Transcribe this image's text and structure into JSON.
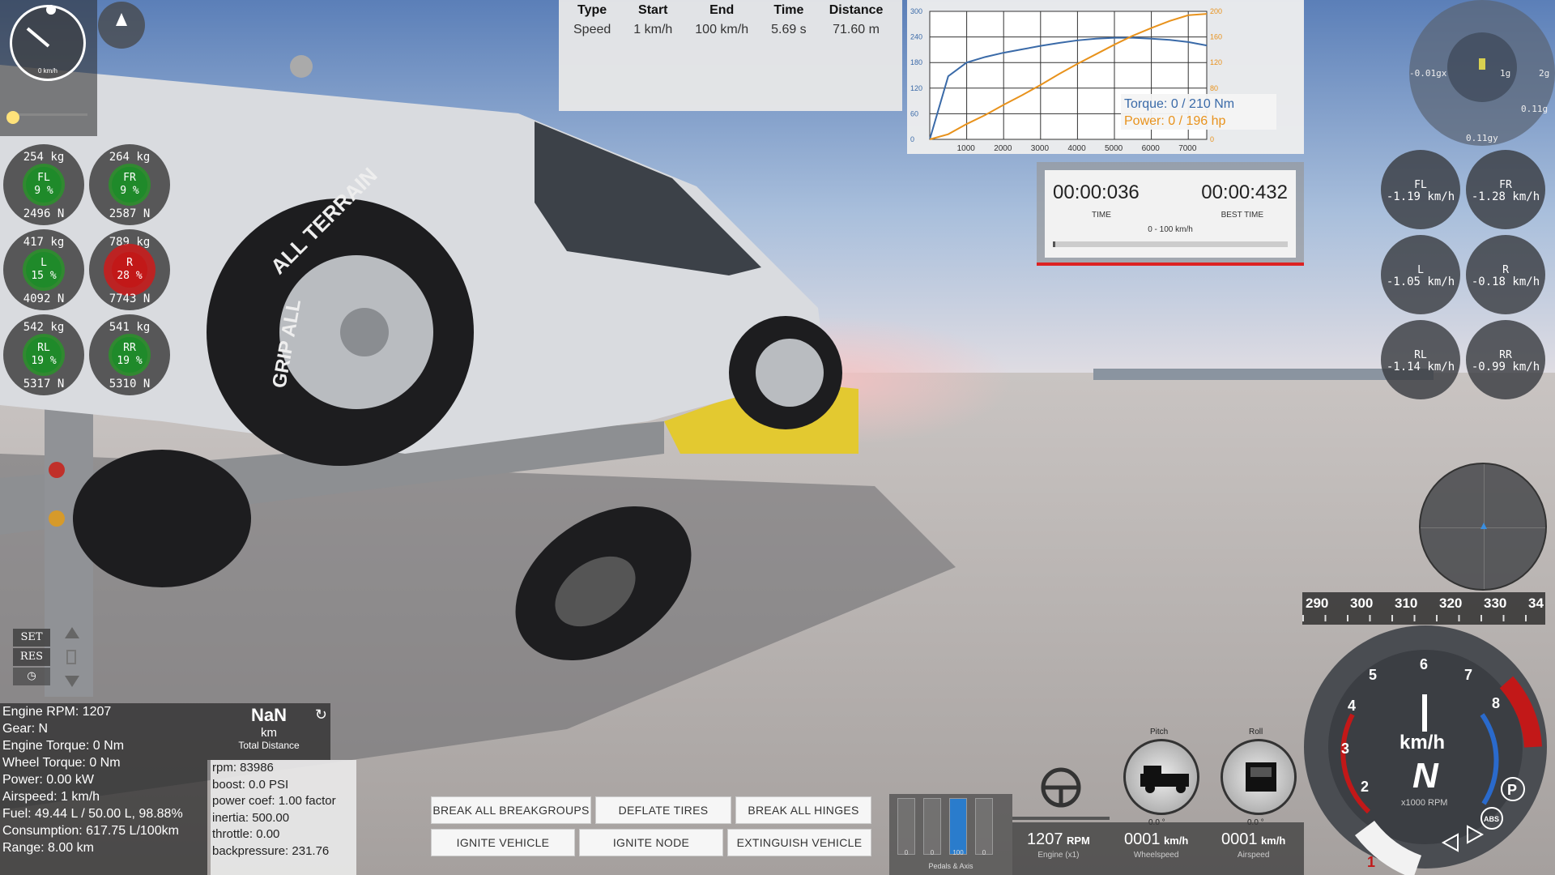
{
  "mini_speedo": {
    "label": "0 km/h"
  },
  "wheel_loads": [
    {
      "id": "FL",
      "kg": "254  kg",
      "label": "FL",
      "pct": "9 %",
      "n": "2496  N",
      "state": "green"
    },
    {
      "id": "FR",
      "kg": "264  kg",
      "label": "FR",
      "pct": "9 %",
      "n": "2587  N",
      "state": "green"
    },
    {
      "id": "L",
      "kg": "417  kg",
      "label": "L",
      "pct": "15 %",
      "n": "4092  N",
      "state": "green"
    },
    {
      "id": "R",
      "kg": "789  kg",
      "label": "R",
      "pct": "28 %",
      "n": "7743  N",
      "state": "red"
    },
    {
      "id": "RL",
      "kg": "542  kg",
      "label": "RL",
      "pct": "19 %",
      "n": "5317  N",
      "state": "green"
    },
    {
      "id": "RR",
      "kg": "541  kg",
      "label": "RR",
      "pct": "19 %",
      "n": "5310  N",
      "state": "green"
    }
  ],
  "drag_table": {
    "headers": [
      "Type",
      "Start",
      "End",
      "Time",
      "Distance"
    ],
    "row": [
      "Speed",
      "1 km/h",
      "100 km/h",
      "5.69 s",
      "71.60 m"
    ]
  },
  "torque_chart": {
    "legend_torque": "Torque: 0 / 210 Nm",
    "legend_power": "Power: 0 / 196 hp"
  },
  "chart_data": {
    "type": "line",
    "x": [
      0,
      500,
      1000,
      1500,
      2000,
      2500,
      3000,
      3500,
      4000,
      4500,
      5000,
      5500,
      6000,
      6500,
      7000,
      7500
    ],
    "series": [
      {
        "name": "Torque",
        "axis": "left",
        "color": "#3a6aa8",
        "values": [
          0,
          148,
          180,
          193,
          203,
          211,
          219,
          226,
          232,
          236,
          238,
          238,
          236,
          233,
          228,
          220
        ]
      },
      {
        "name": "Power",
        "axis": "right",
        "color": "#e8921c",
        "values": [
          0,
          8,
          24,
          38,
          54,
          69,
          85,
          102,
          118,
          133,
          148,
          162,
          174,
          185,
          194,
          196
        ]
      }
    ],
    "x_ticks": [
      "1000",
      "2000",
      "3000",
      "4000",
      "5000",
      "6000",
      "7000"
    ],
    "x_tick_values": [
      1000,
      2000,
      3000,
      4000,
      5000,
      6000,
      7000
    ],
    "y_left_ticks": [
      "0",
      "60",
      "120",
      "180",
      "240",
      "300"
    ],
    "y_right_ticks": [
      "0",
      "40",
      "80",
      "120",
      "160",
      "200"
    ],
    "xlim": [
      0,
      7500
    ],
    "ylim_left": [
      0,
      300
    ],
    "ylim_right": [
      0,
      200
    ],
    "grid": true,
    "legend": "bottom-right"
  },
  "lap_timer": {
    "time": "00:00:036",
    "best_time": "00:00:432",
    "time_label": "TIME",
    "best_label": "BEST TIME",
    "segment": "0 - 100 km/h"
  },
  "gforce": {
    "x": "-0.01gx",
    "y_top": "1g",
    "y_right": "2g",
    "lat": "0.11g",
    "bottom": "0.11gy"
  },
  "wheel_speeds": [
    {
      "id": "FL",
      "label": "FL",
      "value": "-1.19  km/h"
    },
    {
      "id": "FR",
      "label": "FR",
      "value": "-1.28  km/h"
    },
    {
      "id": "L",
      "label": "L",
      "value": "-1.05  km/h"
    },
    {
      "id": "R",
      "label": "R",
      "value": "-0.18  km/h"
    },
    {
      "id": "RL",
      "label": "RL",
      "value": "-1.14  km/h"
    },
    {
      "id": "RR",
      "label": "RR",
      "value": "-0.99  km/h"
    }
  ],
  "speed_tape": [
    "290",
    "300",
    "310",
    "320",
    "330",
    "34"
  ],
  "tacho": {
    "numbers": [
      "1",
      "2",
      "3",
      "4",
      "5",
      "6",
      "7",
      "8"
    ],
    "unit": "km/h",
    "gear": "N",
    "rpm_label": "x1000 RPM",
    "park": "P",
    "abs": "ABS"
  },
  "attitude": {
    "pitch_label": "Pitch",
    "roll_label": "Roll",
    "pitch_value": "0.0 °",
    "roll_value": "0.0 °"
  },
  "pedals": {
    "values": [
      "0",
      "0",
      "100",
      "0"
    ],
    "levels": [
      0,
      0,
      1,
      0
    ],
    "caption": "Pedals & Axis"
  },
  "readouts": [
    {
      "value": "1207",
      "unit": "RPM",
      "caption": "Engine (x1)"
    },
    {
      "value": "0001",
      "unit": "km/h",
      "caption": "Wheelspeed"
    },
    {
      "value": "0001",
      "unit": "km/h",
      "caption": "Airspeed"
    }
  ],
  "buttons": {
    "break_breakgroups": "BREAK ALL BREAKGROUPS",
    "deflate_tires": "DEFLATE TIRES",
    "break_hinges": "BREAK ALL HINGES",
    "ignite_vehicle": "IGNITE VEHICLE",
    "ignite_node": "IGNITE NODE",
    "extinguish_vehicle": "EXTINGUISH VEHICLE"
  },
  "cruise": {
    "set": "SET",
    "res": "RES"
  },
  "engine_stats": [
    "Engine RPM: 1207",
    "Gear: N",
    "Engine Torque: 0 Nm",
    "Wheel Torque: 0 Nm",
    "Power: 0.00 kW",
    "Airspeed: 1 km/h",
    "Fuel: 49.44 L / 50.00 L, 98.88%",
    "Consumption: 617.75 L/100km",
    "Range: 8.00 km"
  ],
  "trip": {
    "value": "NaN",
    "unit": "km",
    "caption": "Total Distance"
  },
  "turbo": [
    "rpm: 83986",
    "boost: 0.0 PSI",
    "power coef: 1.00 factor",
    "inertia: 500.00",
    "throttle: 0.00",
    "backpressure: 231.76"
  ],
  "colors": {
    "torque": "#3a6aa8",
    "power": "#e8921c",
    "ok": "#1f8a2a",
    "warn": "#c21818",
    "accent": "#2a7ccc"
  },
  "tire_text": [
    "ALL TERRAIN",
    "GRIP ALL"
  ]
}
